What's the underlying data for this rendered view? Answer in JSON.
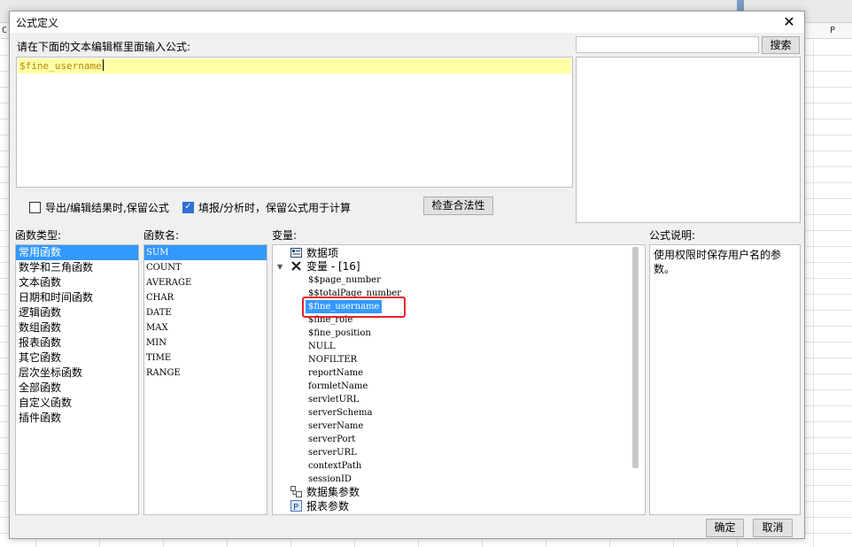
{
  "background": {
    "column_labels": [
      "C",
      "P"
    ]
  },
  "dialog": {
    "title": "公式定义",
    "editor_label": "请在下面的文本编辑框里面输入公式:",
    "formula_text": "$fine_username",
    "search": {
      "value": "",
      "button": "搜索"
    },
    "options": [
      {
        "label": "导出/编辑结果时,保留公式",
        "checked": false
      },
      {
        "label": "填报/分析时，保留公式用于计算",
        "checked": true
      }
    ],
    "check_button": "检查合法性",
    "panels": {
      "types_label": "函数类型:",
      "funcs_label": "函数名:",
      "vars_label": "变量:",
      "desc_label": "公式说明:"
    },
    "function_types": [
      "常用函数",
      "数学和三角函数",
      "文本函数",
      "日期和时间函数",
      "逻辑函数",
      "数组函数",
      "报表函数",
      "其它函数",
      "层次坐标函数",
      "全部函数",
      "自定义函数",
      "插件函数"
    ],
    "function_names": [
      "SUM",
      "COUNT",
      "AVERAGE",
      "CHAR",
      "DATE",
      "MAX",
      "MIN",
      "TIME",
      "RANGE"
    ],
    "variables": {
      "data_items": "数据项",
      "variables_node": "变量 - [16]",
      "items": [
        "$$page_number",
        "$$totalPage_number",
        "$fine_username",
        "$fine_role",
        "$fine_position",
        "NULL",
        "NOFILTER",
        "reportName",
        "formletName",
        "servletURL",
        "serverSchema",
        "serverName",
        "serverPort",
        "serverURL",
        "contextPath",
        "sessionID"
      ],
      "dataset_params": "数据集参数",
      "report_params": "报表参数"
    },
    "description": "使用权限时保存用户名的参数。",
    "ok_button": "确定",
    "cancel_button": "取消"
  },
  "colors": {
    "selection": "#3399ff",
    "editor_highlight": "#ffffa8",
    "annotation": "#e8202a"
  }
}
